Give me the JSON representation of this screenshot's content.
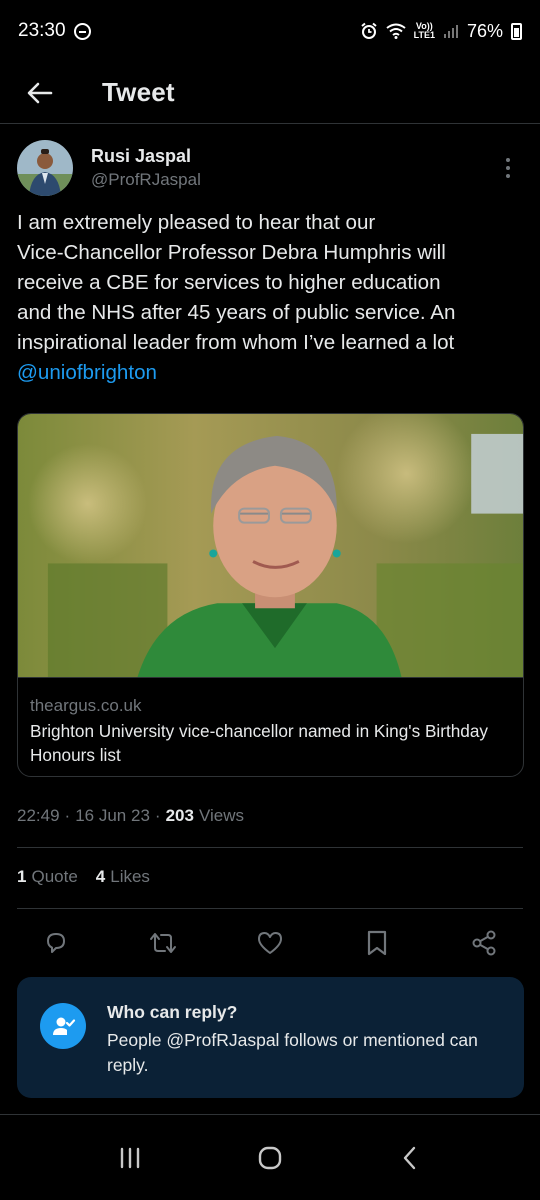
{
  "status_bar": {
    "time": "23:30",
    "lte_top": "Vo))",
    "lte_bottom": "LTE1",
    "battery_percent": "76%",
    "icons": [
      "do-not-disturb-icon",
      "alarm-icon",
      "wifi-icon",
      "signal-icon",
      "battery-icon"
    ]
  },
  "header": {
    "title": "Tweet",
    "back_icon": "arrow-left-icon"
  },
  "author": {
    "name": "Rusi Jaspal",
    "handle": "@ProfRJaspal",
    "more_icon": "more-vertical-icon"
  },
  "tweet": {
    "text": "I am extremely pleased to hear that our\nVice-Chancellor Professor Debra Humphris will\nreceive a CBE for services to higher education\nand the NHS after 45 years of public service. An\ninspirational leader from whom I’ve learned a lot",
    "mention": "@uniofbrighton"
  },
  "link_card": {
    "domain": "theargus.co.uk",
    "title": "Brighton University vice-chancellor named in King's Birthday Honours list"
  },
  "meta": {
    "time": "22:49",
    "separator": "·",
    "date": "16 Jun 23",
    "separator2": "·",
    "views_count": "203",
    "views_label": "Views"
  },
  "stats": {
    "quotes_count": "1",
    "quotes_label": "Quote",
    "likes_count": "4",
    "likes_label": "Likes"
  },
  "actions": [
    "reply-icon",
    "retweet-icon",
    "like-icon",
    "bookmark-icon",
    "share-icon"
  ],
  "reply_restriction": {
    "title": "Who can reply?",
    "description": "People @ProfRJaspal follows or mentioned can reply."
  },
  "nav": [
    "recent-apps-icon",
    "home-icon",
    "back-icon"
  ],
  "colors": {
    "background": "#000000",
    "accent": "#1d9bf0",
    "secondary_text": "#71767b",
    "reply_box": "#0b2136"
  }
}
